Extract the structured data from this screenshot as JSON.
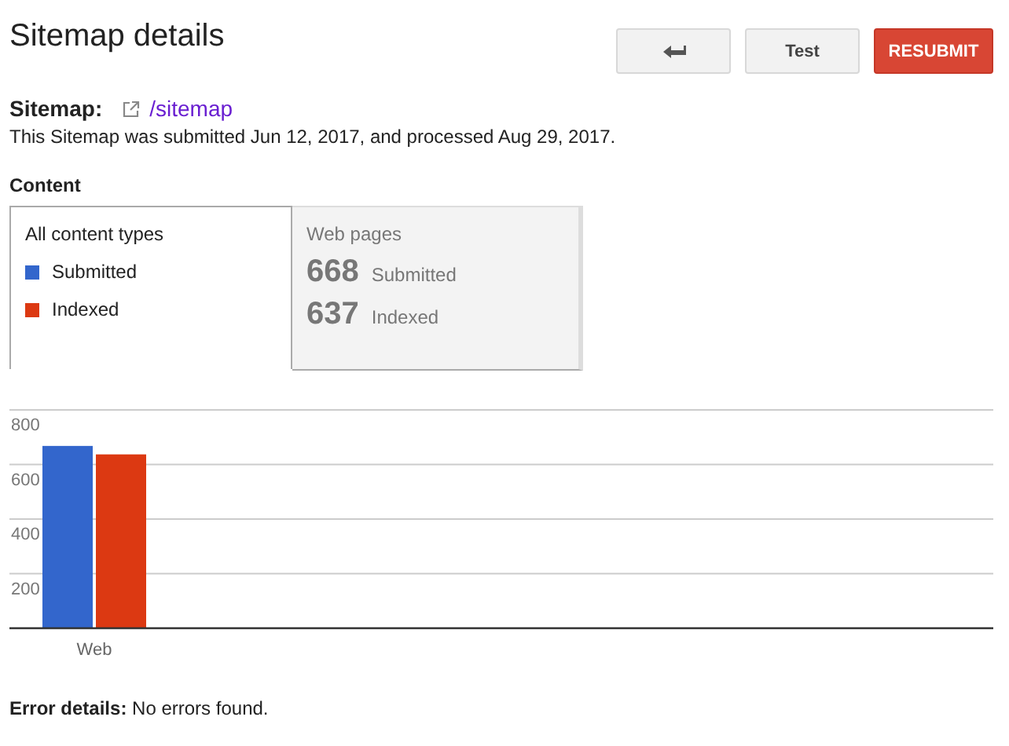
{
  "title": "Sitemap details",
  "buttons": [
    {
      "kind": "back"
    },
    {
      "kind": "plain",
      "label": "Test"
    },
    {
      "kind": "primary",
      "label": "RESUBMIT"
    }
  ],
  "sitemap": {
    "label": "Sitemap:",
    "link": "/sitemap"
  },
  "summary": "This Sitemap was submitted Jun 12, 2017, and processed Aug 29, 2017.",
  "content_heading": "Content",
  "tabs": [
    {
      "title": "All content types",
      "selected": true,
      "kind": "legend"
    },
    {
      "title": "Web pages",
      "selected": false,
      "stats": [
        {
          "value": "668",
          "label": "Submitted"
        },
        {
          "value": "637",
          "label": "Indexed"
        }
      ]
    }
  ],
  "chart_data": {
    "type": "bar",
    "categories": [
      "Web"
    ],
    "series": [
      {
        "name": "Submitted",
        "color": "#3366cc",
        "values": [
          668
        ]
      },
      {
        "name": "Indexed",
        "color": "#dc3912",
        "values": [
          637
        ]
      }
    ],
    "ylim": [
      0,
      800
    ],
    "yticks": [
      200,
      400,
      600,
      800
    ],
    "grid": true
  },
  "error": {
    "label": "Error details:",
    "text": "No errors found."
  }
}
